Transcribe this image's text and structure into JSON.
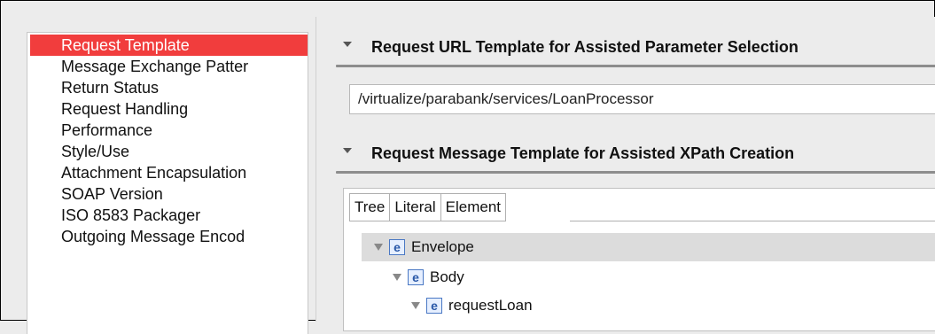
{
  "sidebar": {
    "items": [
      {
        "label": "Request Template",
        "selected": true
      },
      {
        "label": "Message Exchange Patter",
        "selected": false
      },
      {
        "label": "Return Status",
        "selected": false
      },
      {
        "label": "Request Handling",
        "selected": false
      },
      {
        "label": "Performance",
        "selected": false
      },
      {
        "label": "Style/Use",
        "selected": false
      },
      {
        "label": "Attachment Encapsulation",
        "selected": false
      },
      {
        "label": "SOAP Version",
        "selected": false
      },
      {
        "label": "ISO 8583 Packager",
        "selected": false
      },
      {
        "label": "Outgoing Message Encod",
        "selected": false
      }
    ]
  },
  "sections": {
    "url_template": {
      "title": "Request URL Template for Assisted Parameter Selection",
      "value": "/virtualize/parabank/services/LoanProcessor"
    },
    "message_template": {
      "title": "Request Message Template for Assisted XPath Creation",
      "tabs": [
        "Tree",
        "Literal",
        "Element"
      ],
      "active_tab": "Tree",
      "tree": [
        {
          "icon": "e",
          "label": "Envelope",
          "selected": true
        },
        {
          "icon": "e",
          "label": "Body",
          "selected": false
        },
        {
          "icon": "e",
          "label": "requestLoan",
          "selected": false
        }
      ]
    }
  },
  "colors": {
    "selection": "#f13d3d",
    "tree_selection": "#dcdcdc"
  }
}
